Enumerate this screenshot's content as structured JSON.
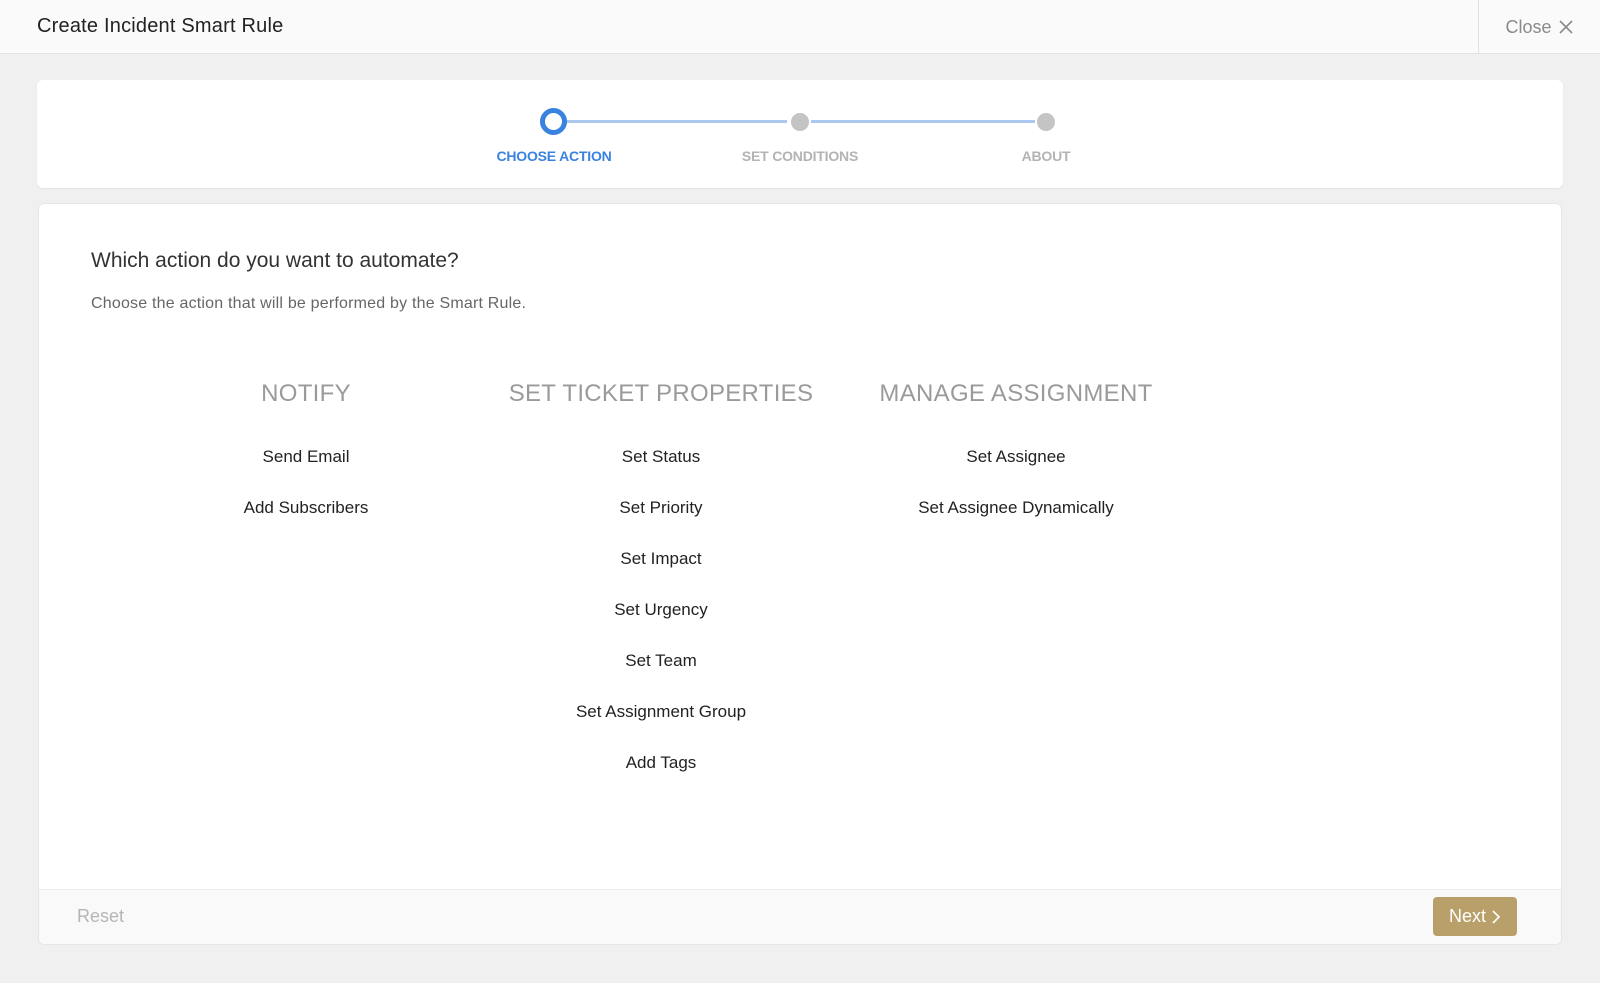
{
  "header": {
    "title": "Create Incident Smart Rule",
    "close_label": "Close"
  },
  "stepper": {
    "steps": [
      {
        "label": "CHOOSE ACTION",
        "state": "active"
      },
      {
        "label": "SET CONDITIONS",
        "state": "inactive"
      },
      {
        "label": "ABOUT",
        "state": "inactive"
      }
    ]
  },
  "main": {
    "question": "Which action do you want to automate?",
    "subtitle": "Choose the action that will be performed by the Smart Rule.",
    "columns": [
      {
        "heading": "NOTIFY",
        "items": [
          "Send Email",
          "Add Subscribers"
        ]
      },
      {
        "heading": "SET TICKET PROPERTIES",
        "items": [
          "Set Status",
          "Set Priority",
          "Set Impact",
          "Set Urgency",
          "Set Team",
          "Set Assignment Group",
          "Add Tags"
        ]
      },
      {
        "heading": "MANAGE ASSIGNMENT",
        "items": [
          "Set Assignee",
          "Set Assignee Dynamically"
        ]
      }
    ]
  },
  "footer": {
    "reset_label": "Reset",
    "next_label": "Next"
  },
  "colors": {
    "accent": "#3a82e0",
    "next_button": "#b9a06a"
  },
  "icons": {
    "close": "close-icon",
    "next": "chevron-right-icon"
  }
}
